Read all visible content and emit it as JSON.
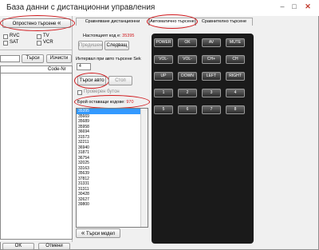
{
  "window": {
    "title": "База данни с дистанционни управления",
    "minimize": "–",
    "maximize": "□",
    "close": "✕"
  },
  "left_panel": {
    "simple_search_label": "Опростено търсене",
    "simple_search_arrows": "«",
    "checkboxes": [
      {
        "label": "RVC"
      },
      {
        "label": "TV"
      },
      {
        "label": "SAT"
      },
      {
        "label": "VCR"
      }
    ],
    "search_label": "Търси",
    "clear_label": "Изчисти",
    "code_column": "Code-Nr",
    "ok_label": "OK",
    "cancel_label": "Отмени"
  },
  "tabs": [
    {
      "label": "Сравняване дистанционни"
    },
    {
      "label": "Автоматично търсене"
    },
    {
      "label": "Сравнително търсене"
    }
  ],
  "auto_search": {
    "current_code_label": "Настоящият код е:",
    "current_code_value": "35395",
    "previous_label": "Предишен",
    "next_label": "Следващ",
    "interval_label": "Интервал при авто търсене Sek",
    "interval_value": "4",
    "search_auto_label": "Търси авто",
    "stop_label": "Стоп",
    "tested_button_label": "Проверен бутон",
    "remaining_codes_label": "Брой оставащи кодове:",
    "remaining_codes_value": "970",
    "search_model_label": "Търси модел",
    "search_model_arrows": "«",
    "codes": [
      "35395",
      "35669",
      "35689",
      "35958",
      "36694",
      "31573",
      "32211",
      "36940",
      "31871",
      "36754",
      "32025",
      "33163",
      "35639",
      "37812",
      "31331",
      "31311",
      "30428",
      "32627",
      "39800"
    ]
  },
  "remote": {
    "rows": [
      [
        "POWER",
        "OK",
        "AV",
        "MUTE"
      ],
      [
        "VOL-",
        "VOL-",
        "CH+",
        "CH"
      ],
      [
        "UP",
        "DOWN",
        "LEFT",
        "RIGHT"
      ],
      [
        "1",
        "2",
        "3",
        "4"
      ],
      [
        "5",
        "6",
        "7",
        "8"
      ]
    ]
  },
  "colors": {
    "highlight": "#d0191d",
    "selection": "#3399ff",
    "remote_body": "#1a1a1a"
  }
}
